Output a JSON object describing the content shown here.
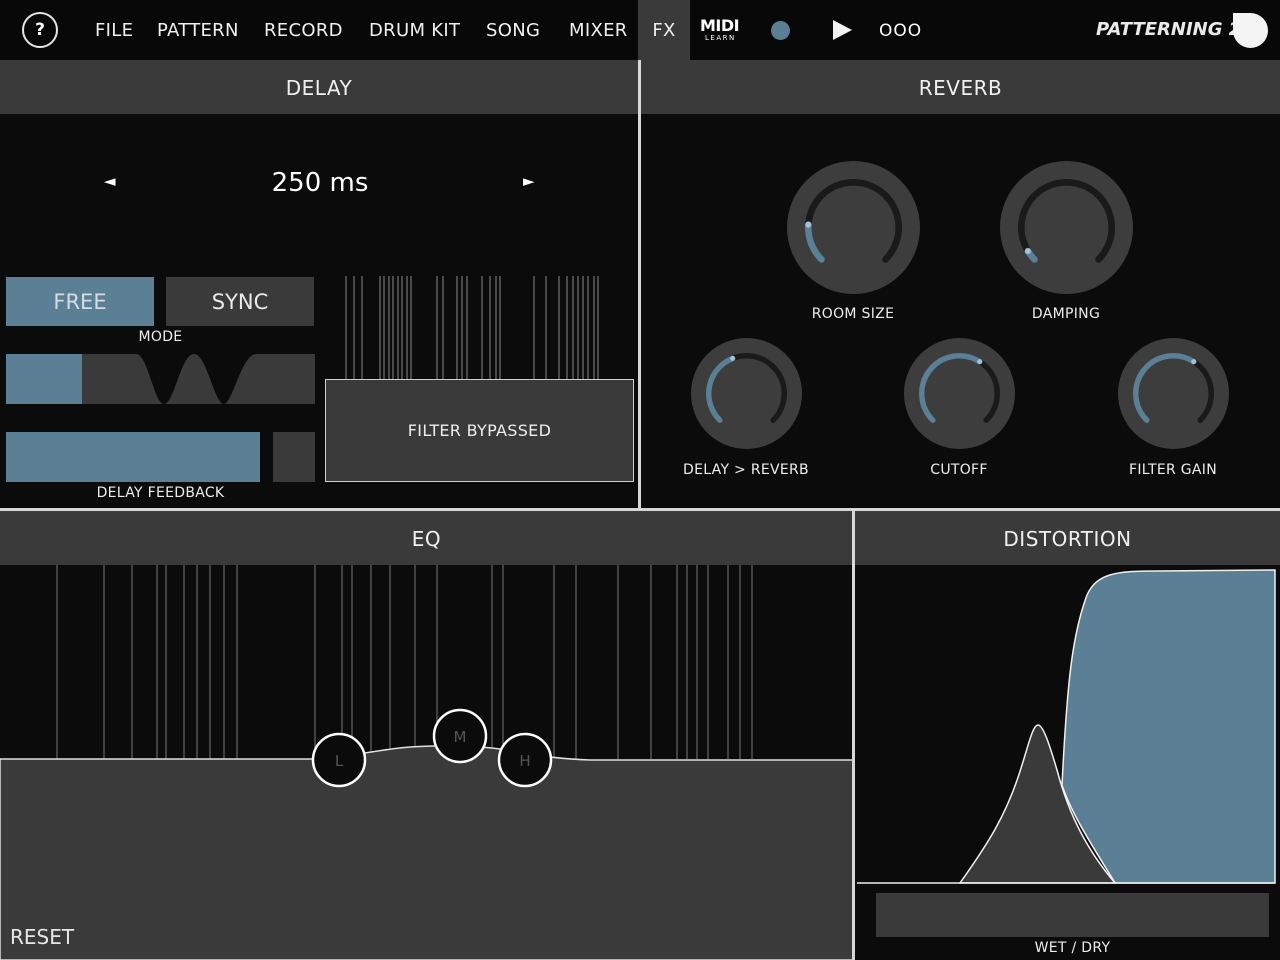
{
  "nav": {
    "help": "?",
    "items": [
      "FILE",
      "PATTERN",
      "RECORD",
      "DRUM KIT",
      "SONG",
      "MIXER",
      "FX"
    ],
    "active": "FX",
    "midi": {
      "title": "MIDI",
      "subtitle": "LEARN"
    },
    "more": "OOO",
    "brand": "PATTERNING 2"
  },
  "delay": {
    "title": "DELAY",
    "time": "250 ms",
    "prev": "◄",
    "next": "►",
    "modes": [
      "FREE",
      "SYNC"
    ],
    "selected_mode": "FREE",
    "mode_label": "MODE",
    "feedback_label": "DELAY FEEDBACK",
    "filter_status": "FILTER BYPASSED"
  },
  "reverb": {
    "title": "REVERB",
    "knobs": [
      {
        "label": "ROOM SIZE",
        "value": 0.18
      },
      {
        "label": "DAMPING",
        "value": 0.05
      },
      {
        "label": "DELAY > REVERB",
        "value": 0.42
      },
      {
        "label": "CUTOFF",
        "value": 0.62
      },
      {
        "label": "FILTER GAIN",
        "value": 0.62
      }
    ]
  },
  "eq": {
    "title": "EQ",
    "bands": [
      "L",
      "M",
      "H"
    ],
    "reset": "RESET"
  },
  "distortion": {
    "title": "DISTORTION",
    "wetdry_label": "WET / DRY"
  },
  "colors": {
    "accent": "#5b7f94",
    "panel": "#3a3a3a",
    "background": "#0b0b0b",
    "knob": "#3d3d3d"
  }
}
